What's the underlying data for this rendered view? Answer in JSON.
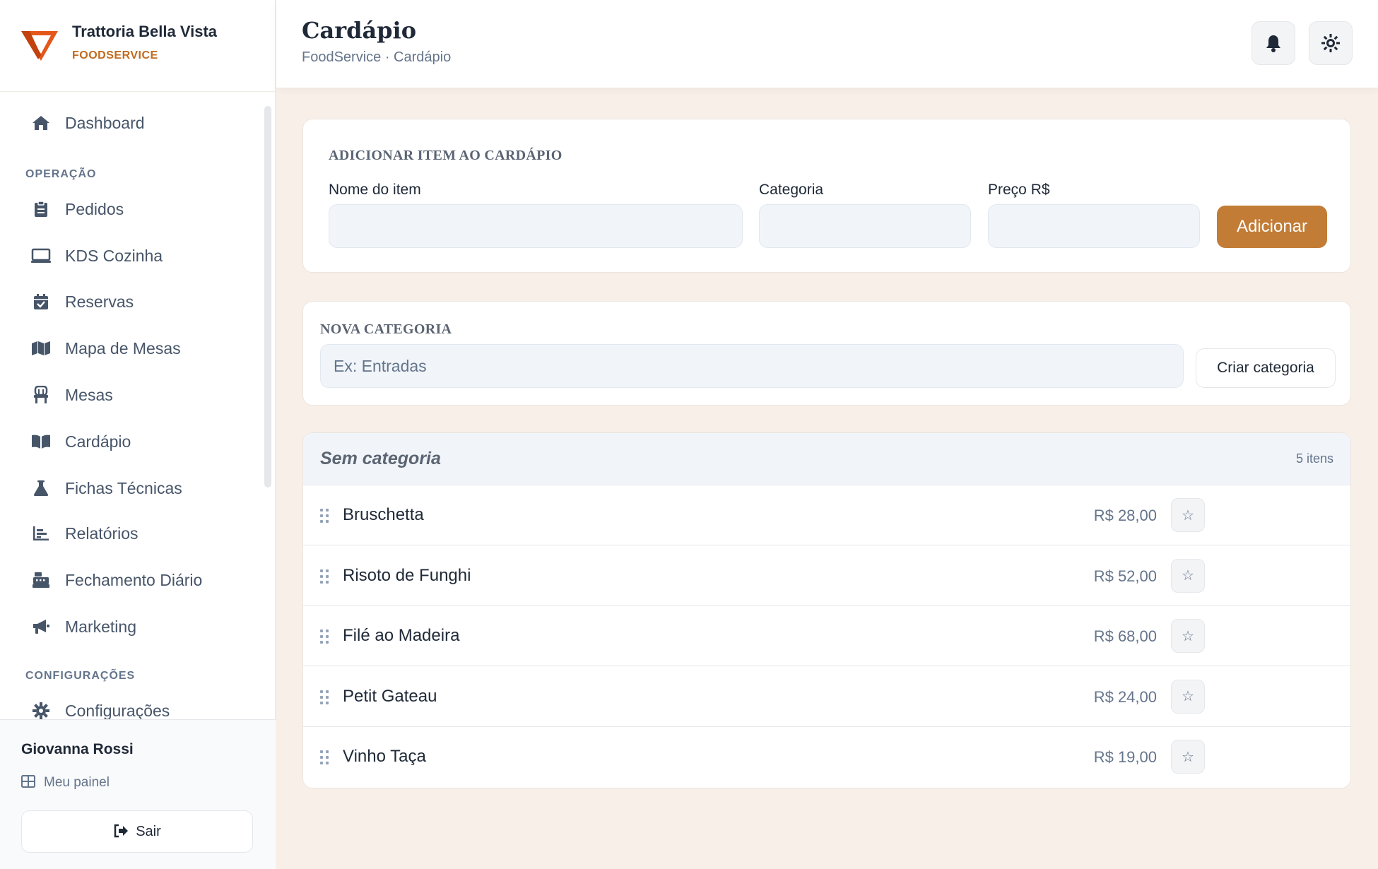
{
  "brand": {
    "name": "Trattoria Bella Vista",
    "subtitle": "FOODSERVICE",
    "accent": "#c26a1f"
  },
  "nav": {
    "dashboard": {
      "label": "Dashboard",
      "icon": "home-icon"
    },
    "section_operacao": "OPERAÇÃO",
    "operacao": [
      {
        "label": "Pedidos",
        "icon": "clipboard-icon"
      },
      {
        "label": "KDS Cozinha",
        "icon": "monitor-icon"
      },
      {
        "label": "Reservas",
        "icon": "calendar-check-icon"
      },
      {
        "label": "Mapa de Mesas",
        "icon": "map-icon"
      },
      {
        "label": "Mesas",
        "icon": "chair-icon"
      },
      {
        "label": "Cardápio",
        "icon": "book-open-icon"
      },
      {
        "label": "Fichas Técnicas",
        "icon": "flask-icon"
      },
      {
        "label": "Relatórios",
        "icon": "bar-chart-icon"
      },
      {
        "label": "Fechamento Diário",
        "icon": "cash-register-icon"
      },
      {
        "label": "Marketing",
        "icon": "megaphone-icon"
      }
    ],
    "section_config": "CONFIGURAÇÕES",
    "config": [
      {
        "label": "Configurações",
        "icon": "gear-icon"
      }
    ]
  },
  "user": {
    "name": "Giovanna Rossi",
    "panel_label": "Meu painel",
    "logout_label": "Sair"
  },
  "header": {
    "title": "Cardápio",
    "breadcrumb": "FoodService · Cardápio"
  },
  "add_item": {
    "title": "Adicionar item ao cardápio",
    "name_label": "Nome do item",
    "name_value": "",
    "category_label": "Categoria",
    "category_value": "",
    "price_label": "Preço R$",
    "price_value": "",
    "button": "Adicionar",
    "button_color": "#c27c36"
  },
  "new_category": {
    "title": "Nova categoria",
    "placeholder": "Ex: Entradas",
    "button": "Criar categoria"
  },
  "group": {
    "title": "Sem categoria",
    "count": "5 itens",
    "items": [
      {
        "name": "Bruschetta",
        "price": "R$ 28,00"
      },
      {
        "name": "Risoto de Funghi",
        "price": "R$ 52,00"
      },
      {
        "name": "Filé ao Madeira",
        "price": "R$ 68,00"
      },
      {
        "name": "Petit Gateau",
        "price": "R$ 24,00"
      },
      {
        "name": "Vinho Taça",
        "price": "R$ 19,00"
      }
    ]
  }
}
